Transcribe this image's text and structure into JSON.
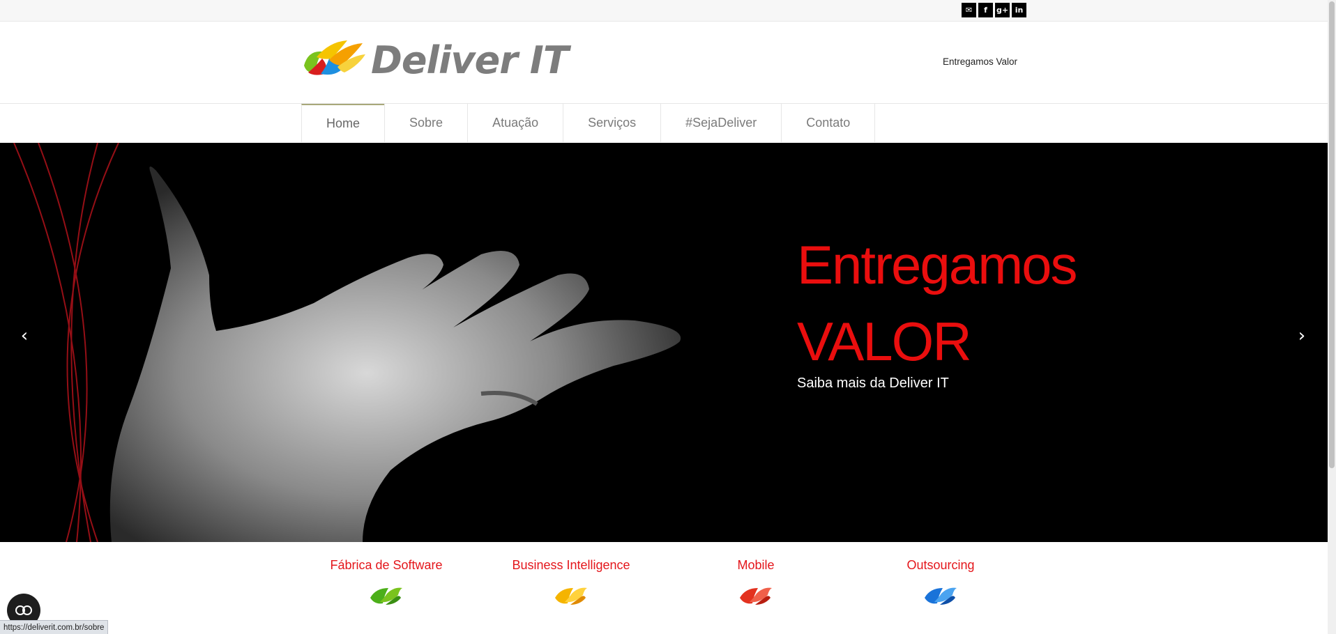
{
  "social": {
    "icons": [
      {
        "name": "email-icon",
        "glyph": "✉"
      },
      {
        "name": "facebook-icon",
        "glyph": "f"
      },
      {
        "name": "google-plus-icon",
        "glyph": "g+"
      },
      {
        "name": "linkedin-icon",
        "glyph": "in"
      }
    ]
  },
  "header": {
    "logo_text": "Deliver IT",
    "tagline": "Entregamos Valor"
  },
  "nav": {
    "items": [
      {
        "label": "Home",
        "active": true
      },
      {
        "label": "Sobre"
      },
      {
        "label": "Atuação"
      },
      {
        "label": "Serviços"
      },
      {
        "label": "#SejaDeliver"
      },
      {
        "label": "Contato"
      }
    ]
  },
  "hero": {
    "title_line1": "Entregamos",
    "title_line2": "VALOR",
    "subtitle": "Saiba mais da Deliver IT",
    "prev_icon": "chevron-left-icon",
    "next_icon": "chevron-right-icon"
  },
  "services": {
    "items": [
      {
        "title": "Fábrica de Software",
        "color": "#4caf1a"
      },
      {
        "title": "Business Intelligence",
        "color": "#f5b400"
      },
      {
        "title": "Mobile",
        "color": "#e3321f"
      },
      {
        "title": "Outsourcing",
        "color": "#1a73d9"
      }
    ]
  },
  "status_url": "https://deliverit.com.br/sobre",
  "colors": {
    "accent_red": "#ea0e0e",
    "service_title": "#e4161b"
  }
}
